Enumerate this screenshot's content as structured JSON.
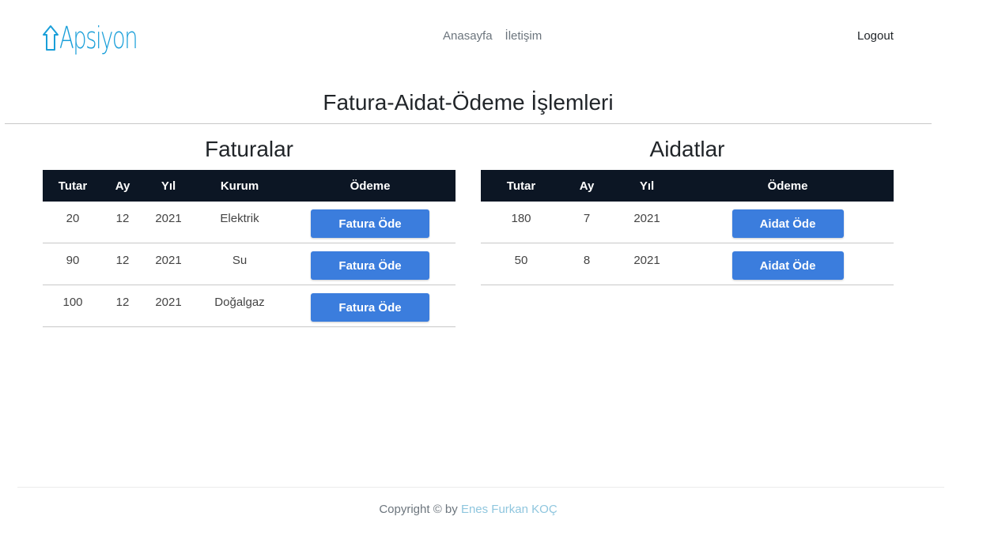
{
  "header": {
    "logo_text": "Apsiyon",
    "nav": [
      "Anasayfa",
      "İletişim"
    ],
    "logout_label": "Logout"
  },
  "page_title": "Fatura-Aidat-Ödeme İşlemleri",
  "faturalar": {
    "title": "Faturalar",
    "columns": [
      "Tutar",
      "Ay",
      "Yıl",
      "Kurum",
      "Ödeme"
    ],
    "rows": [
      {
        "tutar": "20",
        "ay": "12",
        "yil": "2021",
        "kurum": "Elektrik",
        "button": "Fatura Öde"
      },
      {
        "tutar": "90",
        "ay": "12",
        "yil": "2021",
        "kurum": "Su",
        "button": "Fatura Öde"
      },
      {
        "tutar": "100",
        "ay": "12",
        "yil": "2021",
        "kurum": "Doğalgaz",
        "button": "Fatura Öde"
      }
    ]
  },
  "aidatlar": {
    "title": "Aidatlar",
    "columns": [
      "Tutar",
      "Ay",
      "Yıl",
      "Ödeme"
    ],
    "rows": [
      {
        "tutar": "180",
        "ay": "7",
        "yil": "2021",
        "button": "Aidat Öde"
      },
      {
        "tutar": "50",
        "ay": "8",
        "yil": "2021",
        "button": "Aidat Öde"
      }
    ]
  },
  "footer": {
    "prefix": "Copyright © by",
    "author": "Enes Furkan KOÇ"
  },
  "colors": {
    "brand": "#1a9fd9",
    "table_header_bg": "#0c1624",
    "button_bg": "#3b7ddd",
    "footer_link": "#8fc6de"
  },
  "icons": {
    "logo_icon": "house-outline-icon"
  }
}
